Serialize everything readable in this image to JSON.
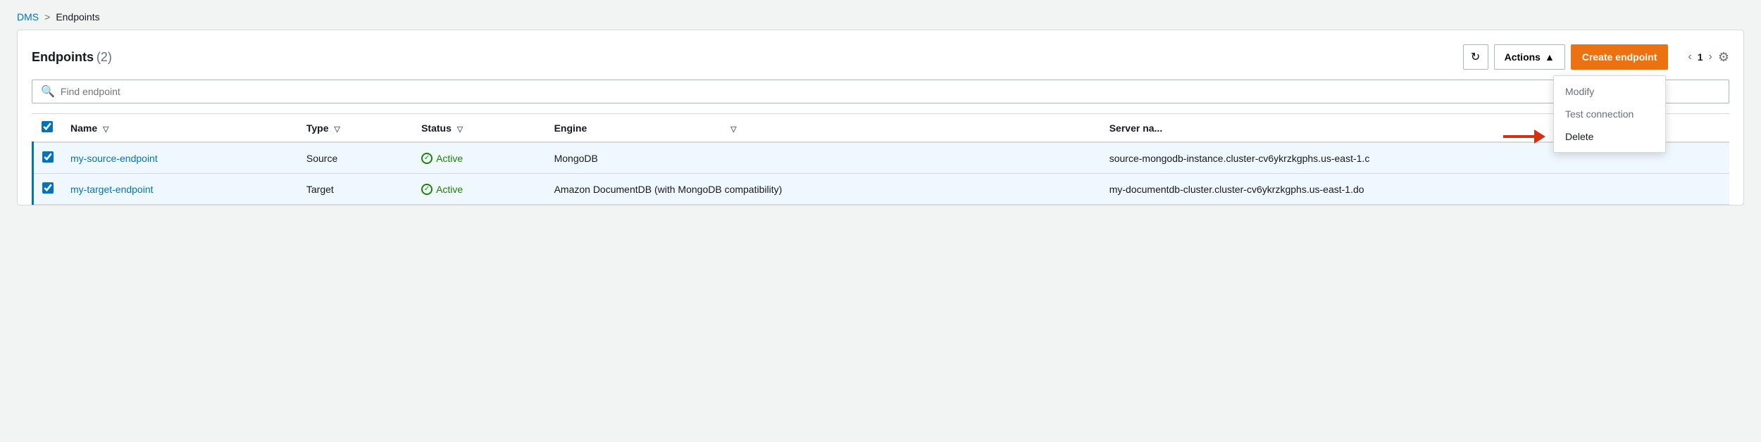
{
  "breadcrumb": {
    "parent": "DMS",
    "separator": ">",
    "current": "Endpoints"
  },
  "panel": {
    "title": "Endpoints",
    "count": "(2)",
    "search_placeholder": "Find endpoint"
  },
  "buttons": {
    "refresh": "↻",
    "actions": "Actions",
    "actions_arrow": "▲",
    "create_endpoint": "Create endpoint"
  },
  "pagination": {
    "page": "1",
    "prev": "‹",
    "next": "›",
    "gear": "⚙"
  },
  "dropdown": {
    "modify": "Modify",
    "test_connection": "Test connection",
    "delete": "Delete"
  },
  "table": {
    "columns": [
      "Name",
      "Type",
      "Status",
      "Engine",
      "Server na..."
    ],
    "rows": [
      {
        "checked": true,
        "name": "my-source-endpoint",
        "type": "Source",
        "status": "Active",
        "engine": "MongoDB",
        "server": "source-mongodb-instance.cluster-cv6ykrzkgphs.us-east-1.c"
      },
      {
        "checked": true,
        "name": "my-target-endpoint",
        "type": "Target",
        "status": "Active",
        "engine": "Amazon DocumentDB (with MongoDB compatibility)",
        "server": "my-documentdb-cluster.cluster-cv6ykrzkgphs.us-east-1.do"
      }
    ]
  }
}
